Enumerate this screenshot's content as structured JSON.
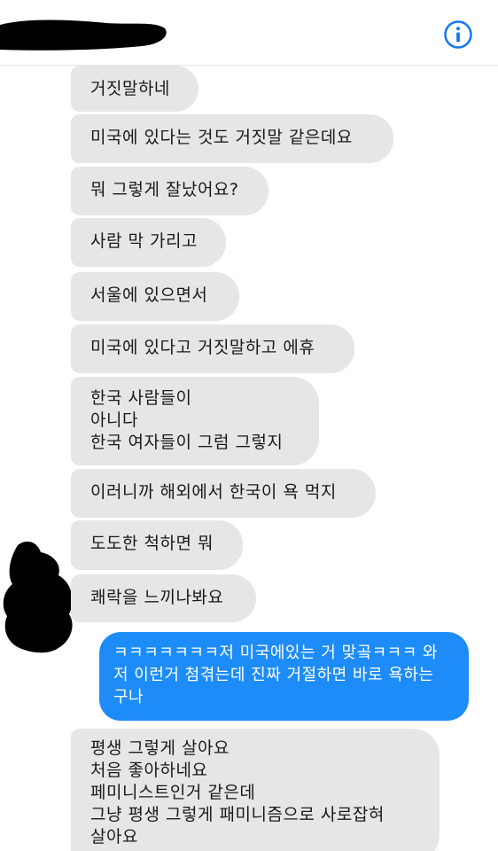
{
  "header": {
    "contact_name_redacted": true,
    "info_icon": "info-circle-icon"
  },
  "colors": {
    "incoming_bubble": "#e6e6e6",
    "outgoing_bubble": "#1d8cf8",
    "accent": "#1877f2",
    "redaction": "#000000"
  },
  "messages": [
    {
      "direction": "in",
      "text": "거짓말하네"
    },
    {
      "direction": "in",
      "text": "미국에 있다는 것도 거짓말 같은데요"
    },
    {
      "direction": "in",
      "text": "뭐 그렇게 잘났어요?"
    },
    {
      "direction": "in",
      "text": "사람 막 가리고"
    },
    {
      "direction": "in",
      "text": "서울에 있으면서"
    },
    {
      "direction": "in",
      "text": "미국에 있다고 거짓말하고 에휴"
    },
    {
      "direction": "in",
      "text": "한국 사람들이\n아니다\n한국 여자들이 그럼 그렇지"
    },
    {
      "direction": "in",
      "text": "이러니까 해외에서 한국이 욕 먹지"
    },
    {
      "direction": "in",
      "text": "도도한 척하면 뭐"
    },
    {
      "direction": "in",
      "text": "쾌락을 느끼나봐요"
    },
    {
      "direction": "out",
      "text": "ㅋㅋㅋㅋㅋㅋㅋ저 미국에있는 거 맞곸ㅋㅋㅋ 와 저 이런거 첨겪는데 진짜 거절하면 바로 욕하는 구나"
    },
    {
      "direction": "in",
      "text": "평생 그렇게 살아요\n처음 좋아하네요\n페미니스트인거 같은데\n그냥 평생 그렇게 패미니즘으로 사로잡혀\n살아요"
    }
  ]
}
